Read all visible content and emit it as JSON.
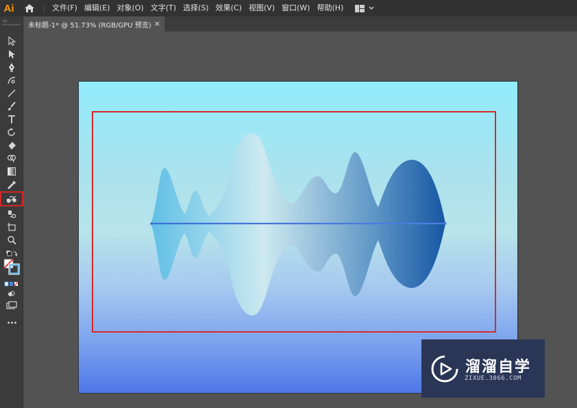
{
  "app": {
    "logo": "Ai"
  },
  "menu": [
    "文件(F)",
    "编辑(E)",
    "对象(O)",
    "文字(T)",
    "选择(S)",
    "效果(C)",
    "视图(V)",
    "窗口(W)",
    "帮助(H)"
  ],
  "tab": {
    "title": "未标题-1* @ 51.73% (RGB/GPU 预览)",
    "close": "×"
  },
  "toolbar": {
    "grip": "››",
    "tools": [
      "selection-tool",
      "direct-selection-tool",
      "pen-tool",
      "curvature-tool",
      "line-tool",
      "paintbrush-tool",
      "type-tool",
      "rotate-tool",
      "eraser-tool",
      "shape-builder-tool",
      "gradient-tool",
      "eyedropper-tool",
      "blend-tool",
      "symbol-sprayer-tool",
      "artboard-tool",
      "zoom-tool",
      "default-colors",
      "fill-stroke",
      "color-mode",
      "draw-mode",
      "screen-mode",
      "more-tools"
    ],
    "active_tool": "blend-tool",
    "more": "•••"
  },
  "colors": {
    "highlight": "#d62828",
    "wave_start": "#5bbde5",
    "wave_mid": "#cfeaf0",
    "wave_end": "#0d4fa0"
  },
  "watermark": {
    "text": "溜溜自学",
    "url": "ZIXUE.3066.COM"
  }
}
